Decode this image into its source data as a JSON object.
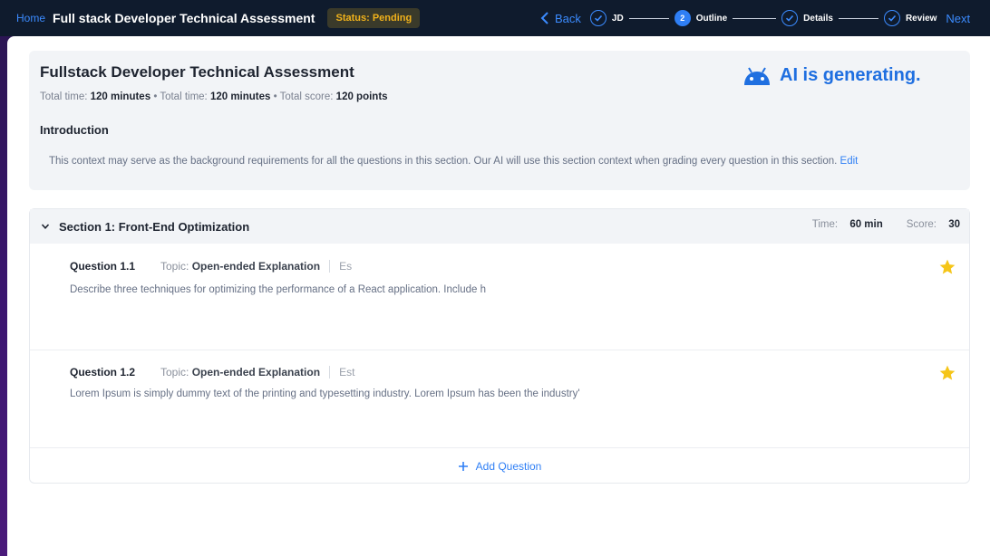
{
  "topbar": {
    "home_label": "Home",
    "title": "Full stack Developer Technical Assessment",
    "status": "Status: Pending",
    "back_label": "Back",
    "next_label": "Next",
    "steps": [
      {
        "label": "JD",
        "state": "done"
      },
      {
        "label": "Outline",
        "state": "active",
        "number": "2"
      },
      {
        "label": "Details",
        "state": "done"
      },
      {
        "label": "Review",
        "state": "done"
      }
    ]
  },
  "header": {
    "title": "Fullstack Developer Technical Assessment",
    "meta_label_1": "Total time:",
    "meta_value_1": "120 minutes",
    "meta_label_2": "Total time:",
    "meta_value_2": "120 minutes",
    "meta_label_3": "Total score:",
    "meta_value_3": "120 points",
    "ai_status": "AI is generating.",
    "intro_heading": "Introduction",
    "intro_text": "This context may serve as the background requirements for all the questions in this section. Our AI will use this section context when grading every question in this section.",
    "edit_label": "Edit"
  },
  "section": {
    "title": "Section 1: Front-End Optimization",
    "time_label": "Time:",
    "time_value": "60 min",
    "score_label": "Score:",
    "score_value": "30",
    "questions": [
      {
        "label": "Question 1.1",
        "topic_label": "Topic:",
        "topic": "Open-ended Explanation",
        "extra": "Es",
        "description": "Describe three techniques for optimizing the performance of a React application. Include h"
      },
      {
        "label": "Question 1.2",
        "topic_label": "Topic:",
        "topic": "Open-ended Explanation",
        "extra": "Est",
        "description": "Lorem Ipsum is simply dummy text of the printing and typesetting industry. Lorem Ipsum has been the industry'"
      }
    ],
    "add_question_label": "Add Question"
  },
  "colors": {
    "accent": "#2f7ff5",
    "status": "#f1b21b",
    "star": "#f5c518",
    "topbar_bg": "#0f1b2d"
  }
}
